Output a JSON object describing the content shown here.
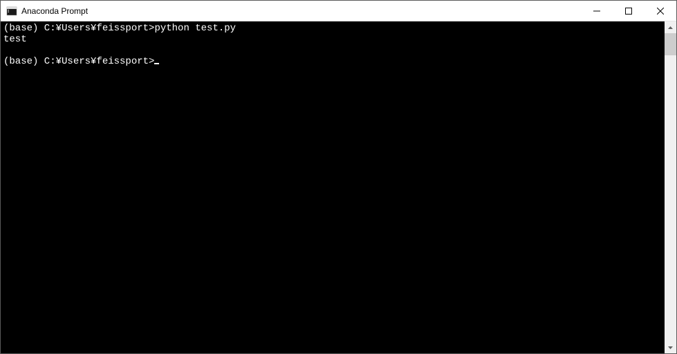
{
  "window": {
    "title": "Anaconda Prompt"
  },
  "terminal": {
    "lines": [
      {
        "prompt": "(base) C:¥Users¥feissport>",
        "command": "python test.py"
      },
      {
        "output": "test"
      },
      {
        "blank": ""
      },
      {
        "prompt": "(base) C:¥Users¥feissport>",
        "command": "",
        "cursor": true
      }
    ]
  }
}
